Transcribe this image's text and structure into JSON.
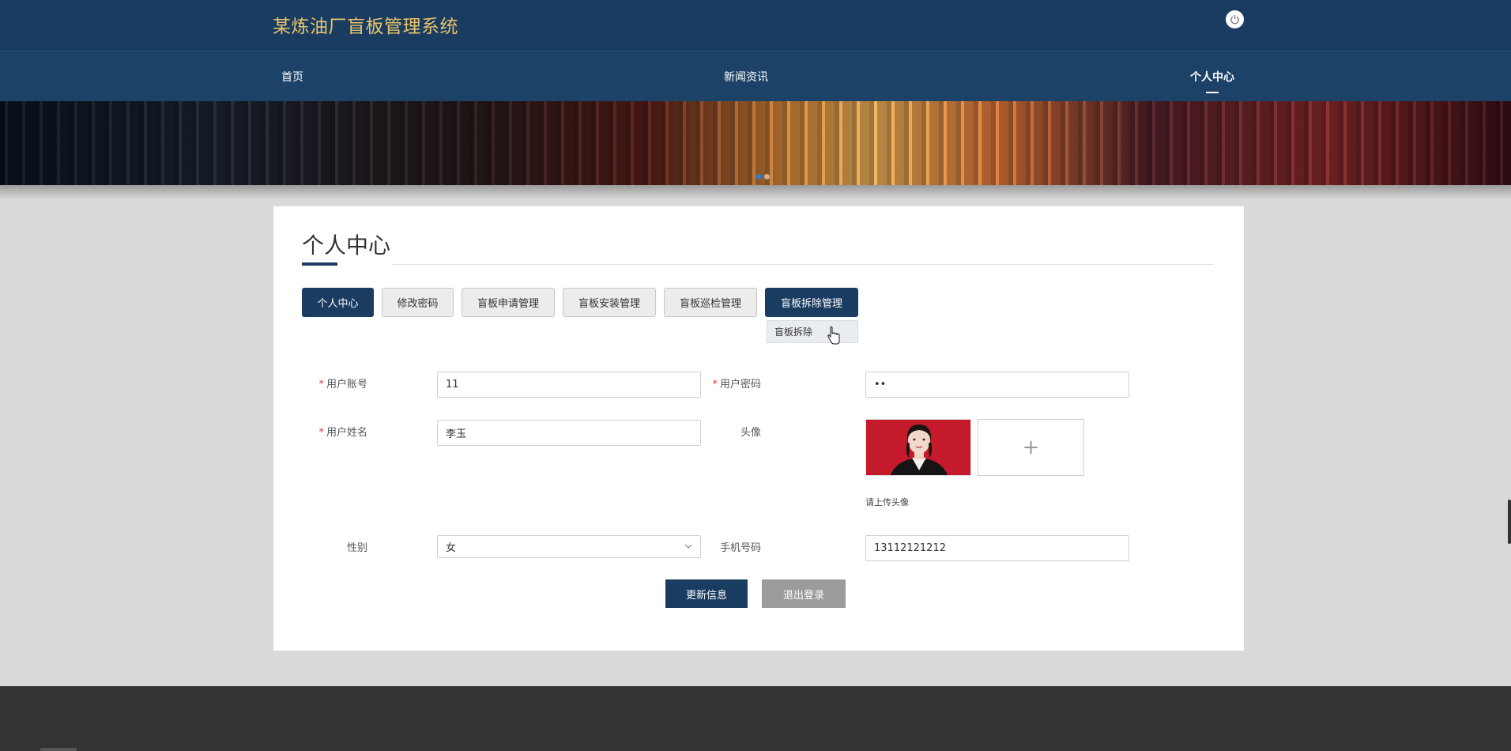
{
  "header": {
    "app_title": "某炼油厂盲板管理系统",
    "power_icon": "power-icon"
  },
  "nav": {
    "items": [
      {
        "label": "首页"
      },
      {
        "label": "新闻资讯"
      },
      {
        "label": "个人中心"
      }
    ],
    "active": "个人中心"
  },
  "banner": {
    "slides_visible": 2,
    "active_slide": 1
  },
  "page": {
    "title": "个人中心"
  },
  "tabs": [
    {
      "label": "个人中心"
    },
    {
      "label": "修改密码"
    },
    {
      "label": "盲板申请管理"
    },
    {
      "label": "盲板安装管理"
    },
    {
      "label": "盲板巡检管理"
    },
    {
      "label": "盲板拆除管理"
    }
  ],
  "dropdown": {
    "items": [
      {
        "label": "盲板拆除"
      }
    ]
  },
  "form": {
    "required_mark": "*",
    "account": {
      "label": "用户账号",
      "value": "11"
    },
    "password": {
      "label": "用户密码",
      "value": "••"
    },
    "name": {
      "label": "用户姓名",
      "value": "李玉"
    },
    "avatar": {
      "label": "头像",
      "upload_hint": "请上传头像",
      "upload_icon": "+"
    },
    "gender": {
      "label": "性别",
      "value": "女"
    },
    "phone": {
      "label": "手机号码",
      "value": "13112121212"
    }
  },
  "actions": {
    "save": "更新信息",
    "logout": "退出登录"
  },
  "colors": {
    "header_bg": "#193c60",
    "brand_text": "#e8c36e",
    "primary": "#193c60",
    "footer_bg": "#333333"
  }
}
